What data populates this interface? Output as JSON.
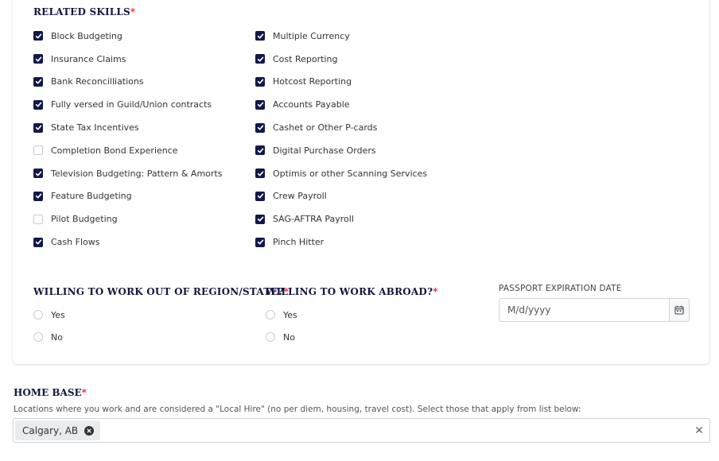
{
  "related_skills": {
    "title": "RELATED SKILLS",
    "required_mark": "*",
    "column_left": [
      {
        "label": "Block Budgeting",
        "checked": true
      },
      {
        "label": "Insurance Claims",
        "checked": true
      },
      {
        "label": "Bank Reconcilliations",
        "checked": true
      },
      {
        "label": "Fully versed in Guild/Union contracts",
        "checked": true
      },
      {
        "label": "State Tax Incentives",
        "checked": true
      },
      {
        "label": "Completion Bond Experience",
        "checked": false
      },
      {
        "label": "Television Budgeting: Pattern & Amorts",
        "checked": true
      },
      {
        "label": "Feature Budgeting",
        "checked": true
      },
      {
        "label": "Pilot Budgeting",
        "checked": false
      },
      {
        "label": "Cash Flows",
        "checked": true
      }
    ],
    "column_right": [
      {
        "label": "Multiple Currency",
        "checked": true
      },
      {
        "label": "Cost Reporting",
        "checked": true
      },
      {
        "label": "Hotcost Reporting",
        "checked": true
      },
      {
        "label": "Accounts Payable",
        "checked": true
      },
      {
        "label": "Cashet or Other P-cards",
        "checked": true
      },
      {
        "label": "Digital Purchase Orders",
        "checked": true
      },
      {
        "label": "Optimis or other Scanning Services",
        "checked": true
      },
      {
        "label": "Crew Payroll",
        "checked": true
      },
      {
        "label": "SAG-AFTRA Payroll",
        "checked": true
      },
      {
        "label": "Pinch Hitter",
        "checked": true
      }
    ]
  },
  "willing_region": {
    "title": "WILLING TO WORK OUT OF REGION/STATE?",
    "required_mark": "*",
    "options": [
      "Yes",
      "No"
    ]
  },
  "willing_abroad": {
    "title": "WILLING TO WORK ABROAD?",
    "required_mark": "*",
    "options": [
      "Yes",
      "No"
    ]
  },
  "passport": {
    "label": "PASSPORT EXPIRATION DATE",
    "placeholder": "M/d/yyyy",
    "value": "",
    "icon": "calendar-icon"
  },
  "home_base": {
    "title": "HOME BASE",
    "required_mark": "*",
    "help_text": "Locations where you work and are considered a \"Local Hire\" (no per diem, housing, travel cost). Select those that apply from list below:",
    "selected": [
      "Calgary, AB"
    ]
  },
  "colors": {
    "checkbox_checked": "#12184a",
    "title_text": "#13173d",
    "required": "#d8273b",
    "border": "#cfd3d9"
  }
}
